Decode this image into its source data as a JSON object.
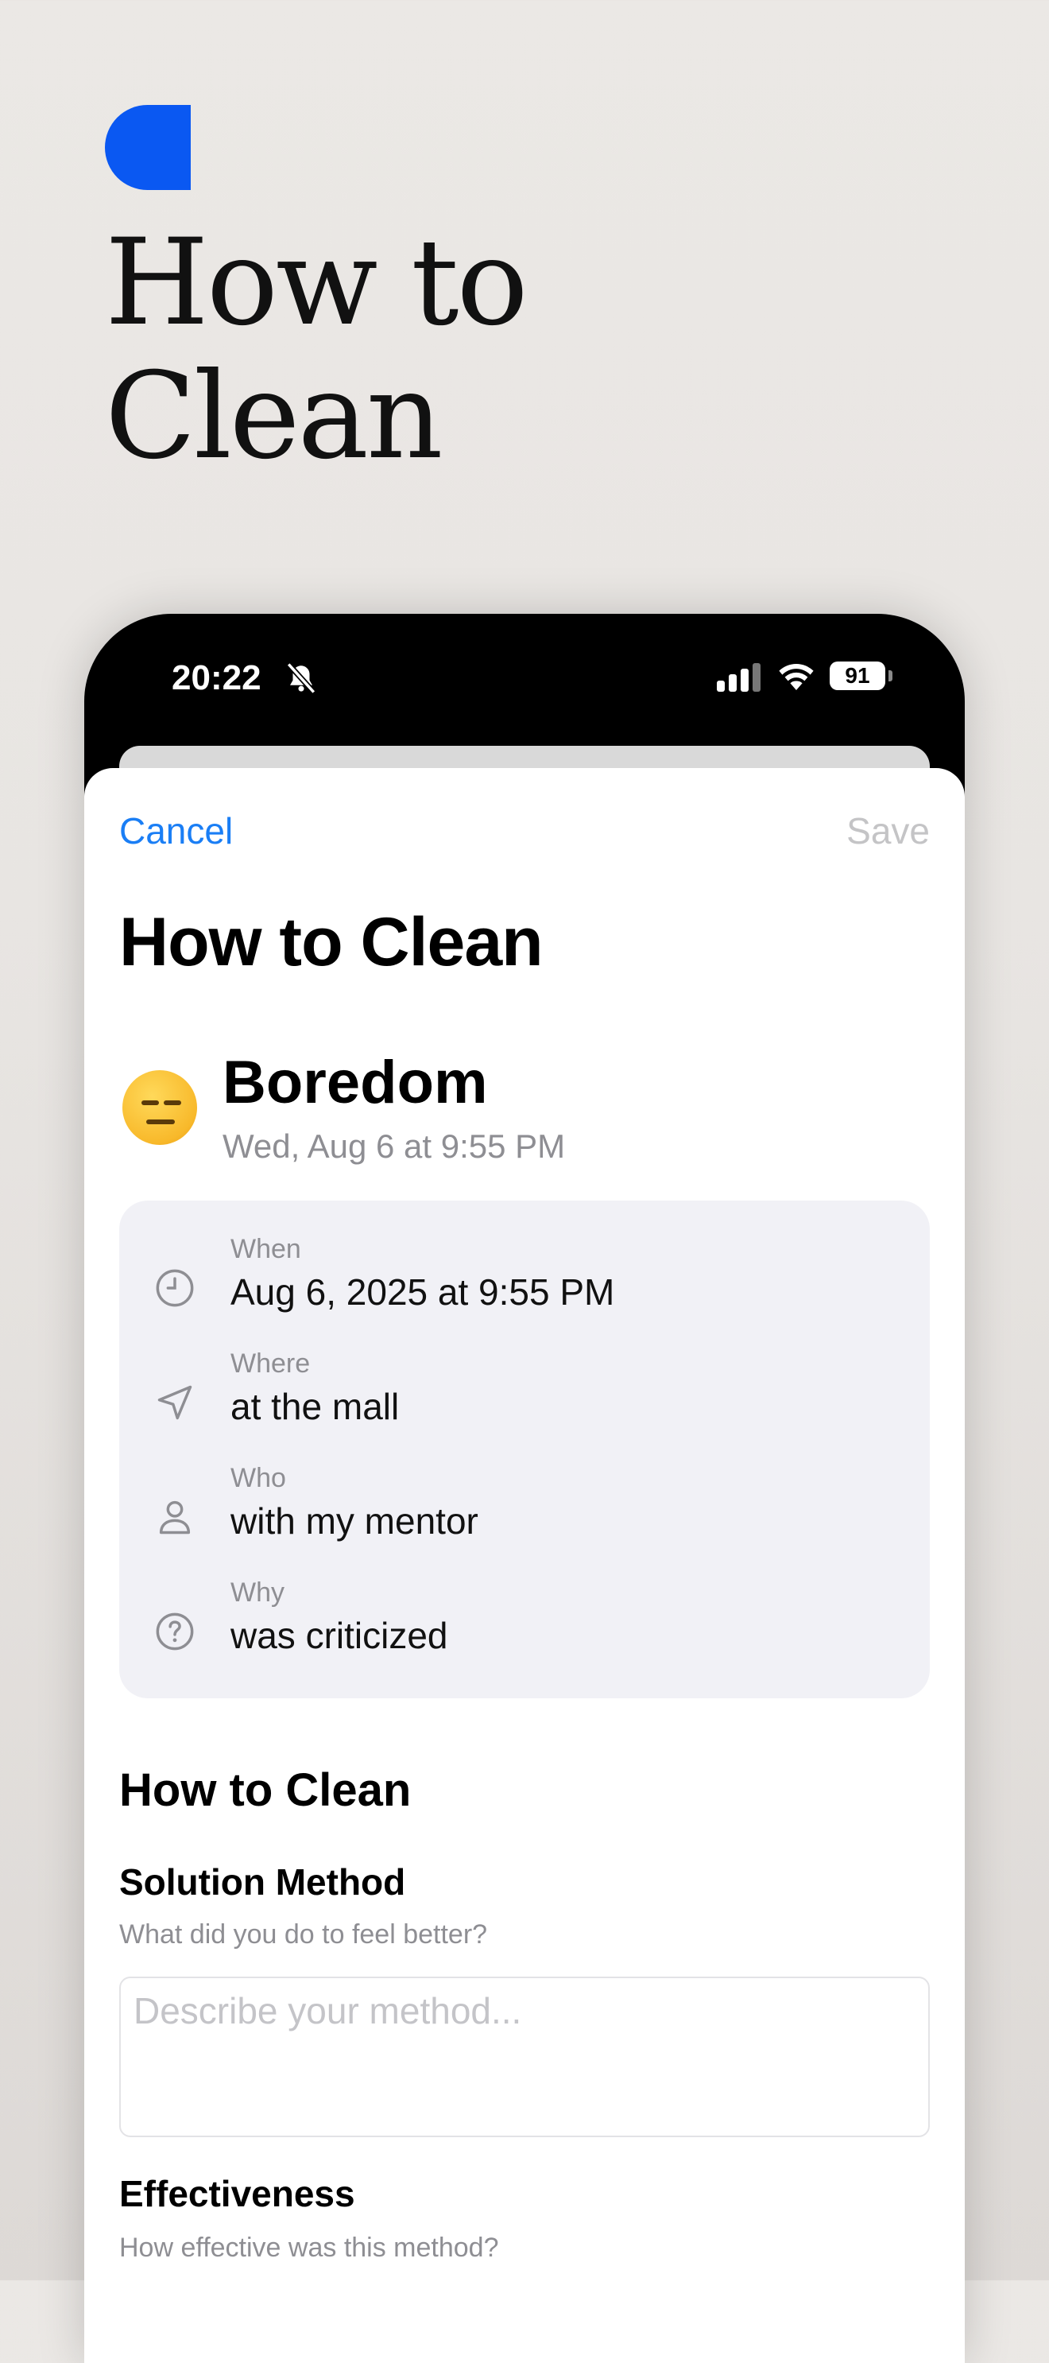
{
  "hero": {
    "title_line1": "How to",
    "title_line2": "Clean",
    "accent_color": "#0a58f2"
  },
  "status_bar": {
    "time": "20:22",
    "battery": "91",
    "icons": [
      "bell-slash-icon",
      "signal-icon",
      "wifi-icon",
      "battery-icon"
    ]
  },
  "nav": {
    "cancel_label": "Cancel",
    "save_label": "Save"
  },
  "page": {
    "title": "How to Clean"
  },
  "emotion": {
    "name": "Boredom",
    "date": "Wed, Aug 6 at 9:55 PM",
    "emoji": "expressionless-face"
  },
  "details": [
    {
      "icon": "clock-icon",
      "label": "When",
      "value": "Aug 6, 2025 at 9:55 PM"
    },
    {
      "icon": "location-arrow-icon",
      "label": "Where",
      "value": "at the mall"
    },
    {
      "icon": "person-icon",
      "label": "Who",
      "value": "with my mentor"
    },
    {
      "icon": "question-circle-icon",
      "label": "Why",
      "value": "was criticized"
    }
  ],
  "section": {
    "title": "How to Clean"
  },
  "solution_method": {
    "title": "Solution Method",
    "help": "What did you do to feel better?",
    "placeholder": "Describe your method..."
  },
  "effectiveness": {
    "title": "Effectiveness",
    "help": "How effective was this method?"
  }
}
